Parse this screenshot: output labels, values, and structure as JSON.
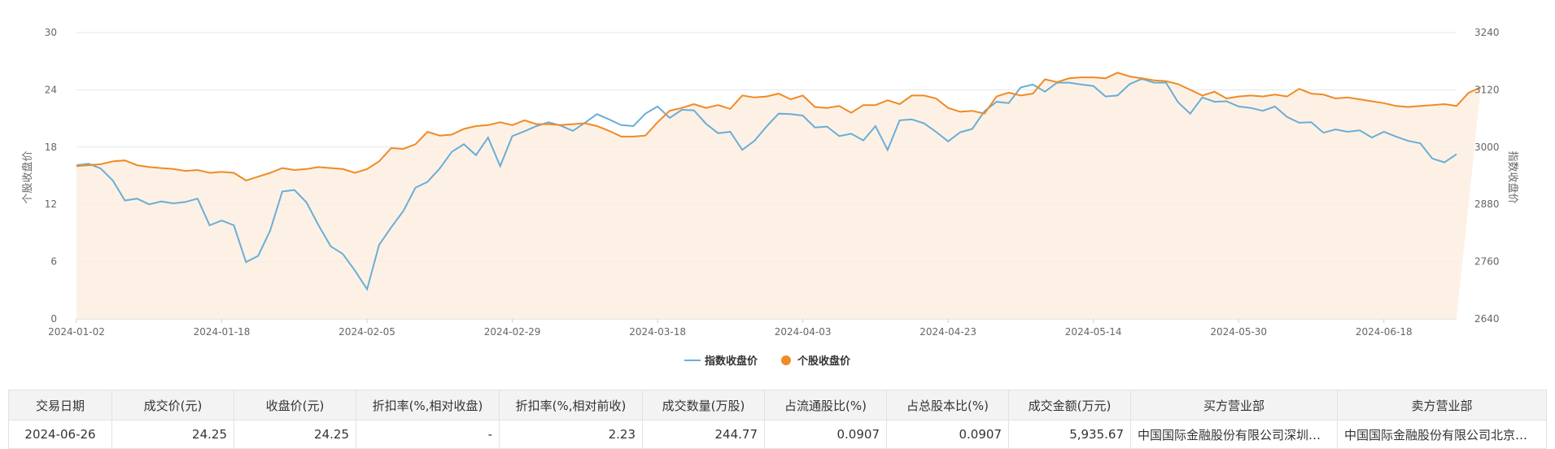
{
  "chart_data": {
    "type": "line",
    "y_left_label": "个股收盘价",
    "y_right_label": "指数收盘价",
    "y_left_ticks": [
      "0",
      "6",
      "12",
      "18",
      "24",
      "30"
    ],
    "y_right_ticks": [
      "2640",
      "2760",
      "2880",
      "3000",
      "3120",
      "3240"
    ],
    "y_left_range": [
      0,
      30
    ],
    "y_right_range": [
      2640,
      3240
    ],
    "x_tick_labels": [
      "2024-01-02",
      "2024-01-18",
      "2024-02-05",
      "2024-02-29",
      "2024-03-18",
      "2024-04-03",
      "2024-04-23",
      "2024-05-14",
      "2024-05-30",
      "2024-06-18"
    ],
    "legend_position": "bottom-center",
    "series": [
      {
        "name": "指数收盘价",
        "axis": "right",
        "color": "#6aaed6",
        "values": [
          2962,
          2965,
          2955,
          2930,
          2888,
          2892,
          2880,
          2886,
          2882,
          2885,
          2892,
          2836,
          2846,
          2836,
          2759,
          2772,
          2825,
          2907,
          2910,
          2884,
          2836,
          2792,
          2776,
          2741,
          2702,
          2795,
          2832,
          2866,
          2915,
          2927,
          2955,
          2990,
          3006,
          2983,
          3020,
          2960,
          3023,
          3033,
          3044,
          3052,
          3045,
          3034,
          3051,
          3069,
          3058,
          3046,
          3044,
          3070,
          3085,
          3061,
          3078,
          3077,
          3049,
          3029,
          3032,
          2994,
          3013,
          3043,
          3070,
          3069,
          3066,
          3041,
          3043,
          3023,
          3028,
          3014,
          3044,
          2994,
          3056,
          3058,
          3050,
          3032,
          3012,
          3031,
          3038,
          3075,
          3095,
          3092,
          3125,
          3131,
          3116,
          3135,
          3135,
          3131,
          3128,
          3106,
          3108,
          3132,
          3143,
          3135,
          3135,
          3094,
          3070,
          3104,
          3095,
          3096,
          3085,
          3082,
          3076,
          3085,
          3063,
          3051,
          3052,
          3030,
          3037,
          3032,
          3035,
          3020,
          3032,
          3022,
          3013,
          3008,
          2976,
          2968,
          2985
        ]
      },
      {
        "name": "个股收盘价",
        "axis": "left",
        "color": "#f08a24",
        "values": [
          16.0,
          16.1,
          16.2,
          16.5,
          16.6,
          16.1,
          15.9,
          15.8,
          15.7,
          15.5,
          15.6,
          15.3,
          15.4,
          15.3,
          14.5,
          14.9,
          15.3,
          15.8,
          15.6,
          15.7,
          15.9,
          15.8,
          15.7,
          15.3,
          15.7,
          16.5,
          17.9,
          17.8,
          18.3,
          19.6,
          19.2,
          19.3,
          19.9,
          20.2,
          20.3,
          20.6,
          20.3,
          20.8,
          20.4,
          20.4,
          20.3,
          20.4,
          20.5,
          20.2,
          19.7,
          19.1,
          19.1,
          19.2,
          20.6,
          21.8,
          22.1,
          22.5,
          22.1,
          22.4,
          22.0,
          23.4,
          23.2,
          23.3,
          23.6,
          23.0,
          23.4,
          22.2,
          22.1,
          22.3,
          21.6,
          22.4,
          22.4,
          22.9,
          22.5,
          23.4,
          23.4,
          23.1,
          22.1,
          21.7,
          21.8,
          21.5,
          23.3,
          23.7,
          23.4,
          23.6,
          25.1,
          24.8,
          25.2,
          25.3,
          25.3,
          25.2,
          25.8,
          25.4,
          25.2,
          25.0,
          24.9,
          24.6,
          24.0,
          23.4,
          23.8,
          23.1,
          23.3,
          23.4,
          23.3,
          23.5,
          23.3,
          24.1,
          23.6,
          23.5,
          23.1,
          23.2,
          23.0,
          22.8,
          22.6,
          22.3,
          22.2,
          22.3,
          22.4,
          22.5,
          22.3,
          23.7,
          24.25
        ]
      }
    ]
  },
  "table": {
    "headers": [
      "交易日期",
      "成交价(元)",
      "收盘价(元)",
      "折扣率(%,相对收盘)",
      "折扣率(%,相对前收)",
      "成交数量(万股)",
      "占流通股比(%)",
      "占总股本比(%)",
      "成交金额(万元)",
      "买方营业部",
      "卖方营业部"
    ],
    "row": {
      "date": "2024-06-26",
      "price": "24.25",
      "close": "24.25",
      "disc_close": "-",
      "disc_prev": "2.23",
      "volume": "244.77",
      "float_pct": "0.0907",
      "total_pct": "0.0907",
      "amount": "5,935.67",
      "buyer": "中国国际金融股份有限公司深圳分公司",
      "seller": "中国国际金融股份有限公司北京分公司"
    }
  }
}
